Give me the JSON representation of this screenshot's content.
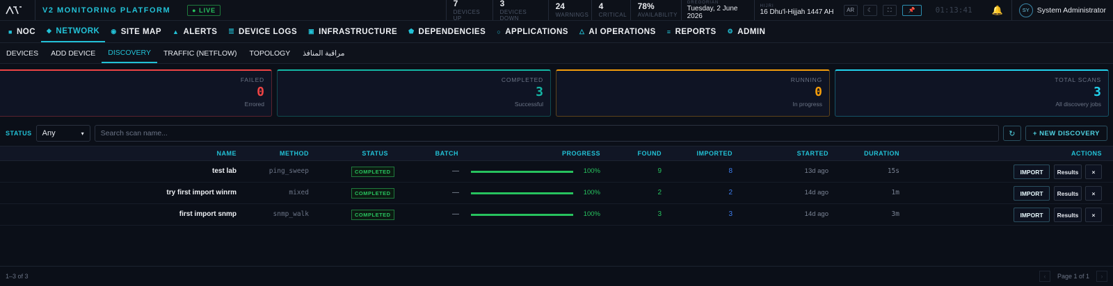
{
  "brand": {
    "title": "V2 MONITORING PLATFORM",
    "live": "● LIVE"
  },
  "stats": [
    {
      "value": "7",
      "label": "DEVICES UP"
    },
    {
      "value": "3",
      "label": "DEVICES DOWN"
    },
    {
      "value": "24",
      "label": "WARNINGS"
    },
    {
      "value": "4",
      "label": "CRITICAL"
    },
    {
      "value": "78%",
      "label": "AVAILABILITY"
    }
  ],
  "dates": {
    "gregorian_label": "GREGORIAN",
    "gregorian": "Tuesday, 2 June 2026",
    "hijri_label": "HIJRI",
    "hijri": "16 Dhu'l-Hijjah 1447 AH"
  },
  "topbar": {
    "lang": "AR",
    "clock": "01:13:41",
    "user_initials": "SY",
    "user_name": "System Administrator"
  },
  "nav": [
    {
      "label": "NOC",
      "icon": "■"
    },
    {
      "label": "NETWORK",
      "icon": "◆"
    },
    {
      "label": "SITE MAP",
      "icon": "◉"
    },
    {
      "label": "ALERTS",
      "icon": "▲"
    },
    {
      "label": "DEVICE LOGS",
      "icon": "☰"
    },
    {
      "label": "INFRASTRUCTURE",
      "icon": "▣"
    },
    {
      "label": "DEPENDENCIES",
      "icon": "⬟"
    },
    {
      "label": "APPLICATIONS",
      "icon": "○"
    },
    {
      "label": "AI OPERATIONS",
      "icon": "△"
    },
    {
      "label": "REPORTS",
      "icon": "≡"
    },
    {
      "label": "ADMIN",
      "icon": "⚙"
    }
  ],
  "subnav": [
    "DEVICES",
    "ADD DEVICE",
    "DISCOVERY",
    "TRAFFIC (NETFLOW)",
    "TOPOLOGY",
    "مراقبة المنافذ"
  ],
  "cards": [
    {
      "title": "FAILED",
      "value": "0",
      "sub": "Errored",
      "color": "#ef4444"
    },
    {
      "title": "COMPLETED",
      "value": "3",
      "sub": "Successful",
      "color": "#14b8a6"
    },
    {
      "title": "RUNNING",
      "value": "0",
      "sub": "In progress",
      "color": "#f59e0b"
    },
    {
      "title": "TOTAL SCANS",
      "value": "3",
      "sub": "All discovery jobs",
      "color": "#22d3ee"
    }
  ],
  "filters": {
    "status_label": "STATUS",
    "status_value": "Any",
    "search_placeholder": "Search scan name...",
    "refresh": "↻",
    "new_button": "+ NEW DISCOVERY"
  },
  "table": {
    "columns": [
      "NAME",
      "METHOD",
      "STATUS",
      "BATCH",
      "PROGRESS",
      "FOUND",
      "IMPORTED",
      "STARTED",
      "DURATION",
      "ACTIONS"
    ],
    "rows": [
      {
        "name": "test lab",
        "method": "ping_sweep",
        "status": "COMPLETED",
        "batch": "—",
        "progress": 1.0,
        "progress_text": "100%",
        "found": "9",
        "imported": "8",
        "started": "13d ago",
        "duration": "15s"
      },
      {
        "name": "try first import winrm",
        "method": "mixed",
        "status": "COMPLETED",
        "batch": "—",
        "progress": 1.0,
        "progress_text": "100%",
        "found": "2",
        "imported": "2",
        "started": "14d ago",
        "duration": "1m"
      },
      {
        "name": "first import snmp",
        "method": "snmp_walk",
        "status": "COMPLETED",
        "batch": "—",
        "progress": 1.0,
        "progress_text": "100%",
        "found": "3",
        "imported": "3",
        "started": "14d ago",
        "duration": "3m"
      }
    ],
    "actions": {
      "import": "IMPORT",
      "results": "Results",
      "delete": "×"
    }
  },
  "footer": {
    "count": "1–3 of 3",
    "page": "Page 1 of 1",
    "prev": "‹",
    "next": "›"
  }
}
